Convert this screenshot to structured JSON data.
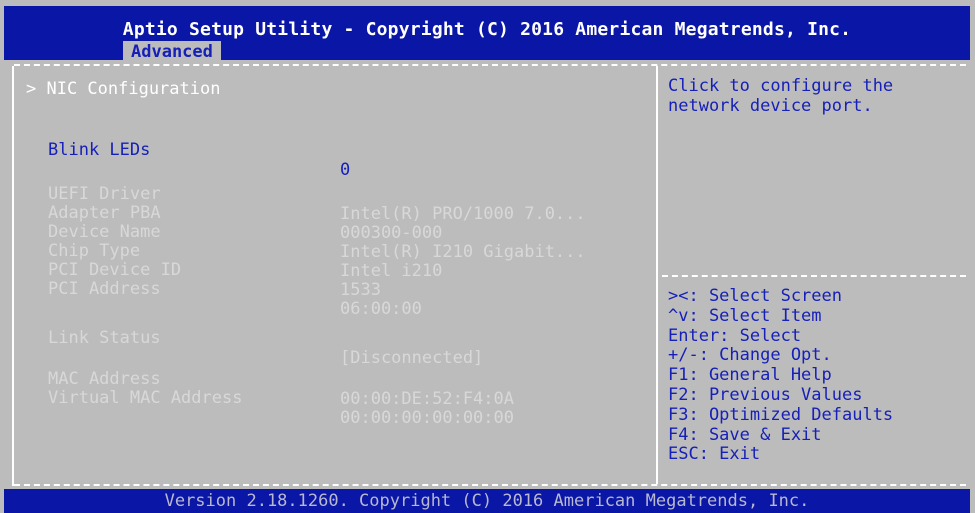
{
  "header": {
    "title": "Aptio Setup Utility - Copyright (C) 2016 American Megatrends, Inc.",
    "active_tab": "Advanced"
  },
  "menu": {
    "nic_configuration": "> NIC Configuration",
    "blink_leds": {
      "label": "Blink LEDs",
      "value": "0"
    },
    "info": [
      {
        "label": "UEFI Driver",
        "value": "Intel(R) PRO/1000 7.0..."
      },
      {
        "label": "Adapter PBA",
        "value": "000300-000"
      },
      {
        "label": "Device Name",
        "value": "Intel(R) I210 Gigabit..."
      },
      {
        "label": "Chip Type",
        "value": "Intel i210"
      },
      {
        "label": "PCI Device ID",
        "value": "1533"
      },
      {
        "label": "PCI Address",
        "value": "06:00:00"
      }
    ],
    "link_status": {
      "label": "Link Status",
      "value": "[Disconnected]"
    },
    "mac": [
      {
        "label": "MAC Address",
        "value": "00:00:DE:52:F4:0A"
      },
      {
        "label": "Virtual MAC Address",
        "value": "00:00:00:00:00:00"
      }
    ]
  },
  "help": {
    "lines": [
      "Click to configure the",
      "network device port."
    ]
  },
  "keys": [
    "><: Select Screen",
    "^v: Select Item",
    "Enter: Select",
    "+/-: Change Opt.",
    "F1: General Help",
    "F2: Previous Values",
    "F3: Optimized Defaults",
    "F4: Save & Exit",
    "ESC: Exit"
  ],
  "footer": {
    "text": "Version 2.18.1260. Copyright (C) 2016 American Megatrends, Inc."
  },
  "colors": {
    "header_bg": "#0a16a6",
    "body_bg": "#bcbcbc",
    "accent_blue": "#1620b8",
    "text_gray": "#d8d8d8"
  }
}
